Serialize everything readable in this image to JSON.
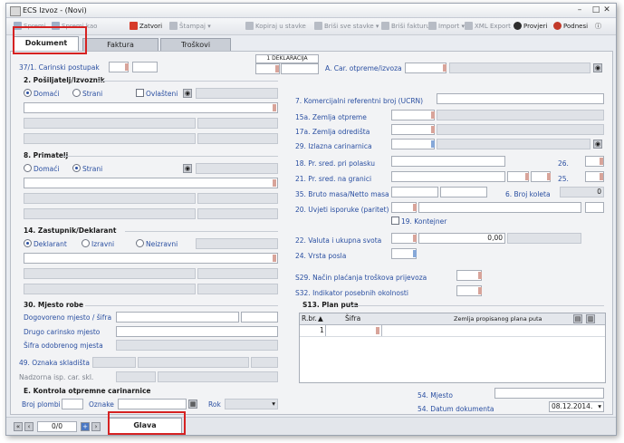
{
  "window": {
    "title": "ECS Izvoz - (Novi)"
  },
  "toolbar": {
    "spremi": "Spremi",
    "spremi_kao": "Spremi kao",
    "zatvori": "Zatvori",
    "stampaj": "Štampaj",
    "kopiraj": "Kopiraj u stavke",
    "brisi_stavke": "Briši sve stavke",
    "brisi_fakturu": "Briši fakturu",
    "import": "Import",
    "xml": "XML Export",
    "provjeri": "Provjeri",
    "podnesi": "Podnesi"
  },
  "tabs": [
    "Dokument",
    "Faktura",
    "Troškovi"
  ],
  "left": {
    "carinski_postupak": "37/1. Carinski postupak",
    "posiljatelj_title": "2. Pošiljatelj/Izvoznik",
    "domaci": "Domaći",
    "strani": "Strani",
    "ovlasteni": "Ovlašteni",
    "primatelj_title": "8. Primatelj",
    "zastupnik_title": "14. Zastupnik/Deklarant",
    "deklarant": "Deklarant",
    "izravni": "Izravni",
    "neizravni": "Neizravni",
    "mjesto_robe_title": "30. Mjesto robe",
    "dogovoreno": "Dogovoreno mjesto / šifra",
    "drugo": "Drugo carinsko mjesto",
    "sifra_odobrenog": "Šifra odobrenog mjesta",
    "oznaka_skladista": "49. Oznaka skladišta",
    "nadzorna": "Nadzorna isp. car. skl.",
    "kontrola_title": "E. Kontrola otpremne carinarnice",
    "broj_plombi": "Broj plombi",
    "oznake": "Oznake",
    "rok": "Rok"
  },
  "right": {
    "deklaracija": "1 DEKLARACIJA",
    "car_otpreme": "A. Car. otpreme/izvoza",
    "ucrn": "7. Komercijalni referentni broj (UCRN)",
    "zemlja_otpreme": "15a. Zemlja otpreme",
    "zemlja_odredista": "17a. Zemlja odredišta",
    "izlazna": "29. Izlazna carinarnica",
    "pr_polasku": "18. Pr. sred. pri polasku",
    "pr_granici": "21. Pr. sred. na granici",
    "bruto": "35. Bruto masa/Netto masa",
    "uvjeti": "20. Uvjeti isporuke (paritet)",
    "kontejner": "19. Kontejner",
    "f26": "26.",
    "f25": "25.",
    "broj_koleta": "6. Broj koleta",
    "broj_koleta_val": "0",
    "valuta": "22. Valuta i ukupna svota",
    "svota": "0,00",
    "vrsta_posla": "24. Vrsta posla",
    "nacin_placanja": "S29. Način plaćanja troškova prijevoza",
    "indikator": "S32. Indikator posebnih okolnosti",
    "plan_puta": "S13. Plan puta",
    "grid_headers": [
      "R.br.",
      "Šifra",
      "Zemlja propisanog plana puta"
    ],
    "grid_row_no": "1",
    "mjesto": "54. Mjesto",
    "datum": "54. Datum dokumenta",
    "datum_val": "08.12.2014."
  },
  "bottom": {
    "pager": "0/0",
    "glava": "Glava"
  },
  "colors": {
    "accent": "#2a4fa1",
    "highlight": "#d62222"
  }
}
